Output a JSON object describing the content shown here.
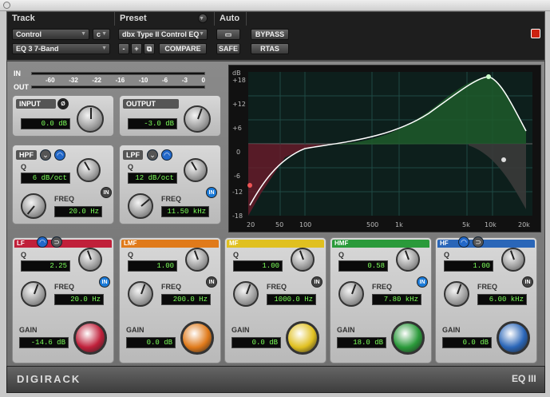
{
  "header": {
    "track": "Track",
    "preset": "Preset",
    "auto": "Auto"
  },
  "track": {
    "name": "Control",
    "channel": "c",
    "insert": "EQ 3 7-Band"
  },
  "preset": {
    "name": "dbx Type II Control EQ",
    "minus": "-",
    "plus": "+",
    "compare": "COMPARE"
  },
  "auto": {
    "bypass": "BYPASS",
    "safe": "SAFE",
    "rtas": "RTAS"
  },
  "meter": {
    "in": "IN",
    "out": "OUT",
    "scale": [
      "-60",
      "-32",
      "-22",
      "-16",
      "-10",
      "-6",
      "-3",
      "0"
    ]
  },
  "input": {
    "label": "INPUT",
    "value": "0.0 dB",
    "phase": "Ø"
  },
  "output": {
    "label": "OUTPUT",
    "value": "-3.0 dB"
  },
  "hpf": {
    "label": "HPF",
    "q": "Q",
    "q_value": "6 dB/oct",
    "freq": "FREQ",
    "freq_value": "20.0 Hz",
    "in": "IN"
  },
  "lpf": {
    "label": "LPF",
    "q": "Q",
    "q_value": "12 dB/oct",
    "freq": "FREQ",
    "freq_value": "11.50 kHz",
    "in": "IN"
  },
  "graph": {
    "ylabel": "dB",
    "y_ticks": [
      "+18",
      "+12",
      "+6",
      "0",
      "-6",
      "-12",
      "-18"
    ],
    "x_ticks": [
      "20",
      "50",
      "100",
      "500",
      "1k",
      "5k",
      "10k",
      "20k"
    ]
  },
  "bands": [
    {
      "label": "LF",
      "q": "Q",
      "q_value": "2.25",
      "freq": "FREQ",
      "freq_value": "20.0 Hz",
      "gain": "GAIN",
      "gain_value": "-14.6 dB",
      "in": "IN",
      "color": "#c0203a"
    },
    {
      "label": "LMF",
      "q": "Q",
      "q_value": "1.00",
      "freq": "FREQ",
      "freq_value": "200.0 Hz",
      "gain": "GAIN",
      "gain_value": "0.0 dB",
      "in": "IN",
      "color": "#e07a1a"
    },
    {
      "label": "MF",
      "q": "Q",
      "q_value": "1.00",
      "freq": "FREQ",
      "freq_value": "1000.0 Hz",
      "gain": "GAIN",
      "gain_value": "0.0 dB",
      "in": "IN",
      "color": "#e0c020"
    },
    {
      "label": "HMF",
      "q": "Q",
      "q_value": "0.58",
      "freq": "FREQ",
      "freq_value": "7.80 kHz",
      "gain": "GAIN",
      "gain_value": "18.0 dB",
      "in": "IN",
      "color": "#2a9a3a"
    },
    {
      "label": "HF",
      "q": "Q",
      "q_value": "1.00",
      "freq": "FREQ",
      "freq_value": "6.00 kHz",
      "gain": "GAIN",
      "gain_value": "0.0 dB",
      "in": "IN",
      "color": "#2a66b8"
    }
  ],
  "footer": {
    "brand": "DIGIRACK",
    "product": "EQ III"
  }
}
